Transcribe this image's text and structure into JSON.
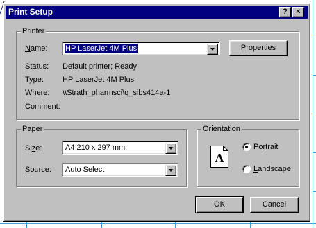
{
  "window": {
    "title": "Print Setup",
    "help_label": "?",
    "close_label": "×"
  },
  "printer": {
    "group_label": "Printer",
    "name_label": "Name:",
    "name_value": "HP LaserJet 4M Plus",
    "properties_label": "Properties",
    "status_label": "Status:",
    "status_value": "Default printer; Ready",
    "type_label": "Type:",
    "type_value": "HP LaserJet 4M Plus",
    "where_label": "Where:",
    "where_value": "\\\\Strath_pharmsci\\q_sibs414a-1",
    "comment_label": "Comment:",
    "comment_value": ""
  },
  "paper": {
    "group_label": "Paper",
    "size_label": "Size:",
    "size_value": "A4 210 x 297 mm",
    "source_label": "Source:",
    "source_value": "Auto Select"
  },
  "orientation": {
    "group_label": "Orientation",
    "icon_letter": "A",
    "portrait_label": "Portrait",
    "landscape_label": "Landscape",
    "selected": "portrait"
  },
  "buttons": {
    "ok_label": "OK",
    "cancel_label": "Cancel"
  },
  "colors": {
    "titlebar": "#000080",
    "face": "#c0c0c0",
    "grid": "#4aa3df"
  }
}
